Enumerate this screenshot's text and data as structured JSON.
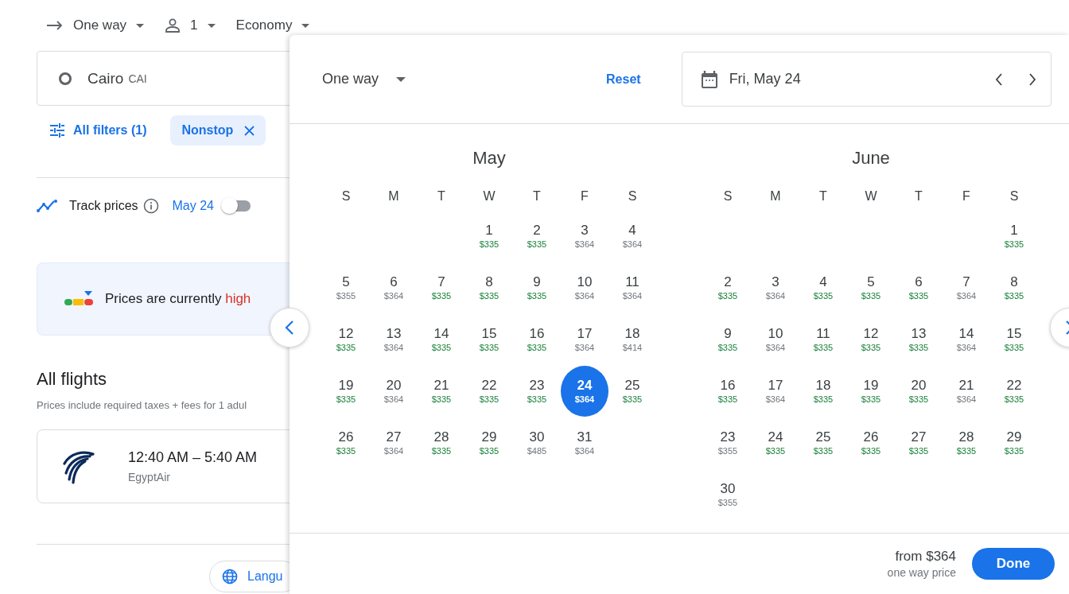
{
  "top_bar": {
    "trip_type": "One way",
    "passengers": "1",
    "cabin": "Economy"
  },
  "origin": {
    "city": "Cairo",
    "code": "CAI"
  },
  "filters": {
    "all_filters": "All filters (1)",
    "chips": [
      {
        "label": "Nonstop"
      }
    ]
  },
  "track_prices": {
    "label": "Track prices",
    "date": "May 24",
    "on": false
  },
  "insight": {
    "text": "Prices are currently",
    "rating": "high"
  },
  "flights": {
    "title": "All flights",
    "subtitle": "Prices include required taxes + fees for 1 adul",
    "items": [
      {
        "times": "12:40 AM – 5:40 AM",
        "airline": "EgyptAir"
      }
    ]
  },
  "language_button": "Langu",
  "calendar": {
    "trip_type": "One way",
    "reset": "Reset",
    "date": "Fri, May 24",
    "months": [
      {
        "name": "May",
        "weekdays": [
          "S",
          "M",
          "T",
          "W",
          "T",
          "F",
          "S"
        ],
        "weeks": [
          {
            "kind": "first",
            "days": [
              {
                "day": "1",
                "price": "$335",
                "low": true,
                "selected": false
              },
              {
                "day": "2",
                "price": "$335",
                "low": true,
                "selected": false
              },
              {
                "day": "3",
                "price": "$364",
                "low": false,
                "selected": false
              },
              {
                "day": "4",
                "price": "$364",
                "low": false,
                "selected": false
              }
            ]
          },
          {
            "days": [
              {
                "day": "5",
                "price": "$355",
                "low": false,
                "selected": false
              },
              {
                "day": "6",
                "price": "$364",
                "low": false,
                "selected": false
              },
              {
                "day": "7",
                "price": "$335",
                "low": true,
                "selected": false
              },
              {
                "day": "8",
                "price": "$335",
                "low": true,
                "selected": false
              },
              {
                "day": "9",
                "price": "$335",
                "low": true,
                "selected": false
              },
              {
                "day": "10",
                "price": "$364",
                "low": false,
                "selected": false
              },
              {
                "day": "11",
                "price": "$364",
                "low": false,
                "selected": false
              }
            ]
          },
          {
            "days": [
              {
                "day": "12",
                "price": "$335",
                "low": true,
                "selected": false
              },
              {
                "day": "13",
                "price": "$364",
                "low": false,
                "selected": false
              },
              {
                "day": "14",
                "price": "$335",
                "low": true,
                "selected": false
              },
              {
                "day": "15",
                "price": "$335",
                "low": true,
                "selected": false
              },
              {
                "day": "16",
                "price": "$335",
                "low": true,
                "selected": false
              },
              {
                "day": "17",
                "price": "$364",
                "low": false,
                "selected": false
              },
              {
                "day": "18",
                "price": "$414",
                "low": false,
                "selected": false
              }
            ]
          },
          {
            "days": [
              {
                "day": "19",
                "price": "$335",
                "low": true,
                "selected": false
              },
              {
                "day": "20",
                "price": "$364",
                "low": false,
                "selected": false
              },
              {
                "day": "21",
                "price": "$335",
                "low": true,
                "selected": false
              },
              {
                "day": "22",
                "price": "$335",
                "low": true,
                "selected": false
              },
              {
                "day": "23",
                "price": "$335",
                "low": true,
                "selected": false
              },
              {
                "day": "24",
                "price": "$364",
                "low": false,
                "selected": true
              },
              {
                "day": "25",
                "price": "$335",
                "low": true,
                "selected": false
              }
            ]
          },
          {
            "kind": "last",
            "days": [
              {
                "day": "26",
                "price": "$335",
                "low": true,
                "selected": false
              },
              {
                "day": "27",
                "price": "$364",
                "low": false,
                "selected": false
              },
              {
                "day": "28",
                "price": "$335",
                "low": true,
                "selected": false
              },
              {
                "day": "29",
                "price": "$335",
                "low": true,
                "selected": false
              },
              {
                "day": "30",
                "price": "$485",
                "low": false,
                "selected": false
              },
              {
                "day": "31",
                "price": "$364",
                "low": false,
                "selected": false
              }
            ]
          }
        ]
      },
      {
        "name": "June",
        "weekdays": [
          "S",
          "M",
          "T",
          "W",
          "T",
          "F",
          "S"
        ],
        "weeks": [
          {
            "kind": "first",
            "days": [
              {
                "day": "1",
                "price": "$335",
                "low": true,
                "selected": false
              }
            ]
          },
          {
            "days": [
              {
                "day": "2",
                "price": "$335",
                "low": true,
                "selected": false
              },
              {
                "day": "3",
                "price": "$364",
                "low": false,
                "selected": false
              },
              {
                "day": "4",
                "price": "$335",
                "low": true,
                "selected": false
              },
              {
                "day": "5",
                "price": "$335",
                "low": true,
                "selected": false
              },
              {
                "day": "6",
                "price": "$335",
                "low": true,
                "selected": false
              },
              {
                "day": "7",
                "price": "$364",
                "low": false,
                "selected": false
              },
              {
                "day": "8",
                "price": "$335",
                "low": true,
                "selected": false
              }
            ]
          },
          {
            "days": [
              {
                "day": "9",
                "price": "$335",
                "low": true,
                "selected": false
              },
              {
                "day": "10",
                "price": "$364",
                "low": false,
                "selected": false
              },
              {
                "day": "11",
                "price": "$335",
                "low": true,
                "selected": false
              },
              {
                "day": "12",
                "price": "$335",
                "low": true,
                "selected": false
              },
              {
                "day": "13",
                "price": "$335",
                "low": true,
                "selected": false
              },
              {
                "day": "14",
                "price": "$364",
                "low": false,
                "selected": false
              },
              {
                "day": "15",
                "price": "$335",
                "low": true,
                "selected": false
              }
            ]
          },
          {
            "days": [
              {
                "day": "16",
                "price": "$335",
                "low": true,
                "selected": false
              },
              {
                "day": "17",
                "price": "$364",
                "low": false,
                "selected": false
              },
              {
                "day": "18",
                "price": "$335",
                "low": true,
                "selected": false
              },
              {
                "day": "19",
                "price": "$335",
                "low": true,
                "selected": false
              },
              {
                "day": "20",
                "price": "$335",
                "low": true,
                "selected": false
              },
              {
                "day": "21",
                "price": "$364",
                "low": false,
                "selected": false
              },
              {
                "day": "22",
                "price": "$335",
                "low": true,
                "selected": false
              }
            ]
          },
          {
            "days": [
              {
                "day": "23",
                "price": "$355",
                "low": false,
                "selected": false
              },
              {
                "day": "24",
                "price": "$335",
                "low": true,
                "selected": false
              },
              {
                "day": "25",
                "price": "$335",
                "low": true,
                "selected": false
              },
              {
                "day": "26",
                "price": "$335",
                "low": true,
                "selected": false
              },
              {
                "day": "27",
                "price": "$335",
                "low": true,
                "selected": false
              },
              {
                "day": "28",
                "price": "$335",
                "low": true,
                "selected": false
              },
              {
                "day": "29",
                "price": "$335",
                "low": true,
                "selected": false
              }
            ]
          },
          {
            "kind": "last",
            "days": [
              {
                "day": "30",
                "price": "$355",
                "low": false,
                "selected": false
              }
            ]
          }
        ]
      }
    ],
    "footer": {
      "price": "from $364",
      "note": "one way price",
      "done": "Done"
    }
  }
}
